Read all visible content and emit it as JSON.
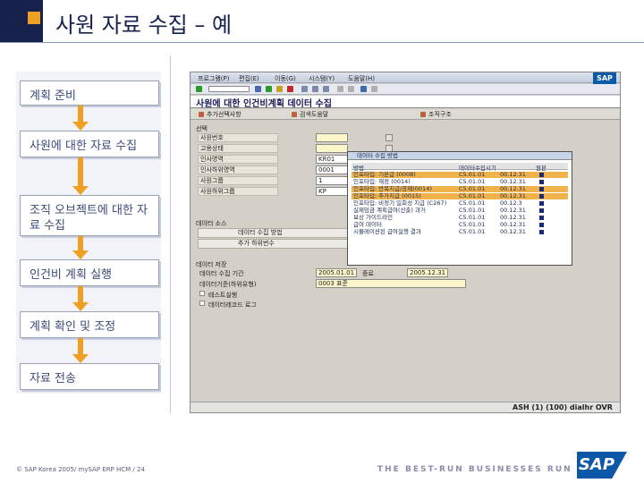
{
  "slide": {
    "title": "사원 자료 수집 – 예",
    "footer_copyright": "©  SAP Korea 2005/  mySAP ERP HCM  /  24",
    "footer_tagline": "THE BEST-RUN BUSINESSES RUN SAP",
    "logo_text": "SAP",
    "accent_color": "#f0a020",
    "brand_color": "#16214e"
  },
  "steps": [
    {
      "label": "계획 준비"
    },
    {
      "label": "사원에 대한 자료 수집"
    },
    {
      "label": "조직 오브젝트에 대한 자료 수집"
    },
    {
      "label": "인건비 계획 실행"
    },
    {
      "label": "계획 확인 및 조정"
    },
    {
      "label": "자료 전송"
    }
  ],
  "sap": {
    "menu": [
      "프로그램(P)",
      "편집(E)",
      "이동(G)",
      "시스템(Y)",
      "도움말(H)"
    ],
    "logo": "SAP",
    "screen_title": "사원에 대한 인건비계획 데이터 수집",
    "app_buttons": [
      "추가선택사항",
      "검색도움말",
      "조직구조"
    ],
    "selection_title": "선택",
    "fields": [
      {
        "label": "사원번호",
        "value": ""
      },
      {
        "label": "고용상태",
        "value": ""
      },
      {
        "label": "인사영역",
        "value": "KR01"
      },
      {
        "label": "인사하위영역",
        "value": "0001"
      },
      {
        "label": "사원그룹",
        "value": "1"
      },
      {
        "label": "사원하위그룹",
        "value": "KP"
      }
    ],
    "datasource_title": "데이터 소스",
    "datasource_rows": [
      "데이터 수집 방법",
      "추가 하위번수"
    ],
    "datastore_title": "데이터 저장",
    "period_label": "데이터 수집 기간",
    "period_from": "2005.01.01",
    "period_to_label": "종료",
    "period_to": "2005.12.31",
    "basis_label": "데이터기준(하위유형)",
    "basis_value": "0003 표준",
    "test_run": "테스트실행",
    "record_log": "데이터레코드 로그",
    "status": "ASH (1) (100)  dialhr  OVR"
  },
  "popup": {
    "title": "데이터 수집 방법",
    "headers": [
      "방법",
      "데이터수집시기",
      "원본"
    ],
    "rows": [
      {
        "method": "인포타입: 기본급 (0008)",
        "time": "C5.01.01",
        "val": "00.12.31",
        "selected": true
      },
      {
        "method": "인포타입: 재정 (0014)",
        "time": "C5.01.01",
        "val": "00.12.31",
        "selected": false
      },
      {
        "method": "인포타입: 반복지급/공제(0014)",
        "time": "C5.01.01",
        "val": "00.12.31",
        "selected": true
      },
      {
        "method": "인포타입: 추가지급 (0015)",
        "time": "C5.01.01",
        "val": "00.12.31",
        "selected": true
      },
      {
        "method": "인포타입: 비정기 일회성 지급 (C267)",
        "time": "C5.01.01",
        "val": "00.12.3",
        "selected": false
      },
      {
        "method": "실제임금 계획급여(산출) 과거",
        "time": "C5.01.01",
        "val": "00.12.31",
        "selected": false
      },
      {
        "method": "보상 가이드라인",
        "time": "C5.01.01",
        "val": "00.12.31",
        "selected": false
      },
      {
        "method": "급여 데이터",
        "time": "C5.01.01",
        "val": "00.12.31",
        "selected": false
      },
      {
        "method": "시뮬레이션된 급여실행 결과",
        "time": "C5.01.01",
        "val": "00.12.31",
        "selected": false
      }
    ]
  }
}
